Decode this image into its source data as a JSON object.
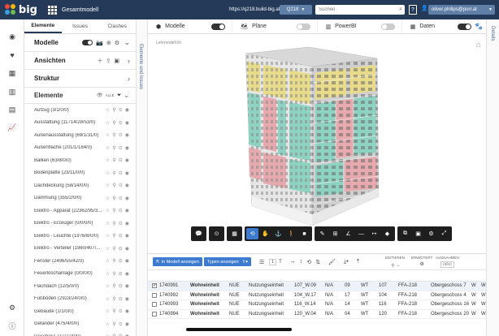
{
  "header": {
    "logo_text": "big",
    "project_title": "Gesamtmodell",
    "url": "https://q218.build-big.at",
    "project_button": "Q218",
    "search_placeholder": "Suchen",
    "help_label": "?",
    "user": "oliver.philips@porr.at"
  },
  "panel": {
    "tabs": [
      "Elemente",
      "Issues",
      "Clashes"
    ],
    "sections": {
      "modelle": "Modelle",
      "ansichten": "Ansichten",
      "struktur": "Struktur",
      "elemente": "Elemente",
      "alle": "ALLE"
    },
    "element_items": [
      "Aufzug (3/1/0/0)",
      "Ausstattung (11714/28/53/0)",
      "Außenausstattung (69/1/31/0)",
      "Außenfläche (201/1/184/0)",
      "Balken (63/8/0/0)",
      "Bodenplatte (23/11/0/0)",
      "Dachdeckung (58/14/0/0)",
      "Dämmung (355/2/0/0)",
      "Elektro - Apparat (22362/95/3...",
      "Elektro - Erzeuger (0/0/0/0)",
      "Elektro - Leuchte (1976/8/0/0)",
      "Elektro - Verteiler (1960/407/...",
      "Fenster (2496/55/42/0)",
      "Feuerlöschanlage (0/0/0/0)",
      "Flachdach (12/5/0/0)",
      "Fußboden (2923/24/0/0)",
      "Gebäude (1/1/0/0)",
      "Geländer (475/4/0/0)",
      "Geschoss (27/27/0/0)"
    ]
  },
  "side_labels": {
    "left": "Elemente und Issues",
    "right": "Details"
  },
  "model_bar": {
    "modelle": "Modelle",
    "plaene": "Pläne",
    "powerbi": "PowerBI",
    "daten": "Daten",
    "modelle_on": true,
    "plaene_on": false,
    "powerbi_on": false,
    "daten_on": true
  },
  "viewer": {
    "label": "Lehrmodell.ifc"
  },
  "table": {
    "btn_show_in_model": "In Modell anzeigen",
    "btn_show_types": "Typen anzeigen",
    "page_num": "1",
    "group_editieren": "EDITIEREN",
    "group_erweitert": "ERWEITERT",
    "group_ausnahmen": "AUSNAHMEN",
    "ausnahmen_value": "(alle)",
    "rows": [
      {
        "id": "1740991",
        "name": "Wohneinheit",
        "c1": "NUE",
        "c2": "Nutzungseinheit",
        "c3": "107_W.09",
        "c4": "N/A",
        "c5": "09",
        "c6": "WT",
        "c7": "107",
        "c8": "FFA-218",
        "c9": "Obergeschoss 7",
        "c10": "W",
        "c11": "W",
        "selected": true
      },
      {
        "id": "1740992",
        "name": "Wohneinheit",
        "c1": "NUE",
        "c2": "Nutzungseinheit",
        "c3": "104_W.17",
        "c4": "N/A",
        "c5": "17",
        "c6": "WT",
        "c7": "104",
        "c8": "FFA-218",
        "c9": "Obergeschoss 4",
        "c10": "W",
        "c11": "W",
        "selected": false
      },
      {
        "id": "1740993",
        "name": "Wohneinheit",
        "c1": "NUE",
        "c2": "Nutzungseinheit",
        "c3": "116_W.14",
        "c4": "N/A",
        "c5": "14",
        "c6": "WT",
        "c7": "116",
        "c8": "FFA-218",
        "c9": "Obergeschoss 16",
        "c10": "W",
        "c11": "W",
        "selected": false
      },
      {
        "id": "1740994",
        "name": "Wohneinheit",
        "c1": "NUE",
        "c2": "Nutzungseinheit",
        "c3": "120_W.04",
        "c4": "N/A",
        "c5": "04",
        "c6": "WT",
        "c7": "120",
        "c8": "FFA-218",
        "c9": "Obergeschoss 20",
        "c10": "W",
        "c11": "W",
        "selected": false
      }
    ]
  },
  "colors": {
    "topbar": "#243a58",
    "accent": "#3d7bd0",
    "unit_yellow": "#e8dc8c",
    "unit_teal": "#8ed3c2",
    "unit_pink": "#e6a9ad"
  }
}
